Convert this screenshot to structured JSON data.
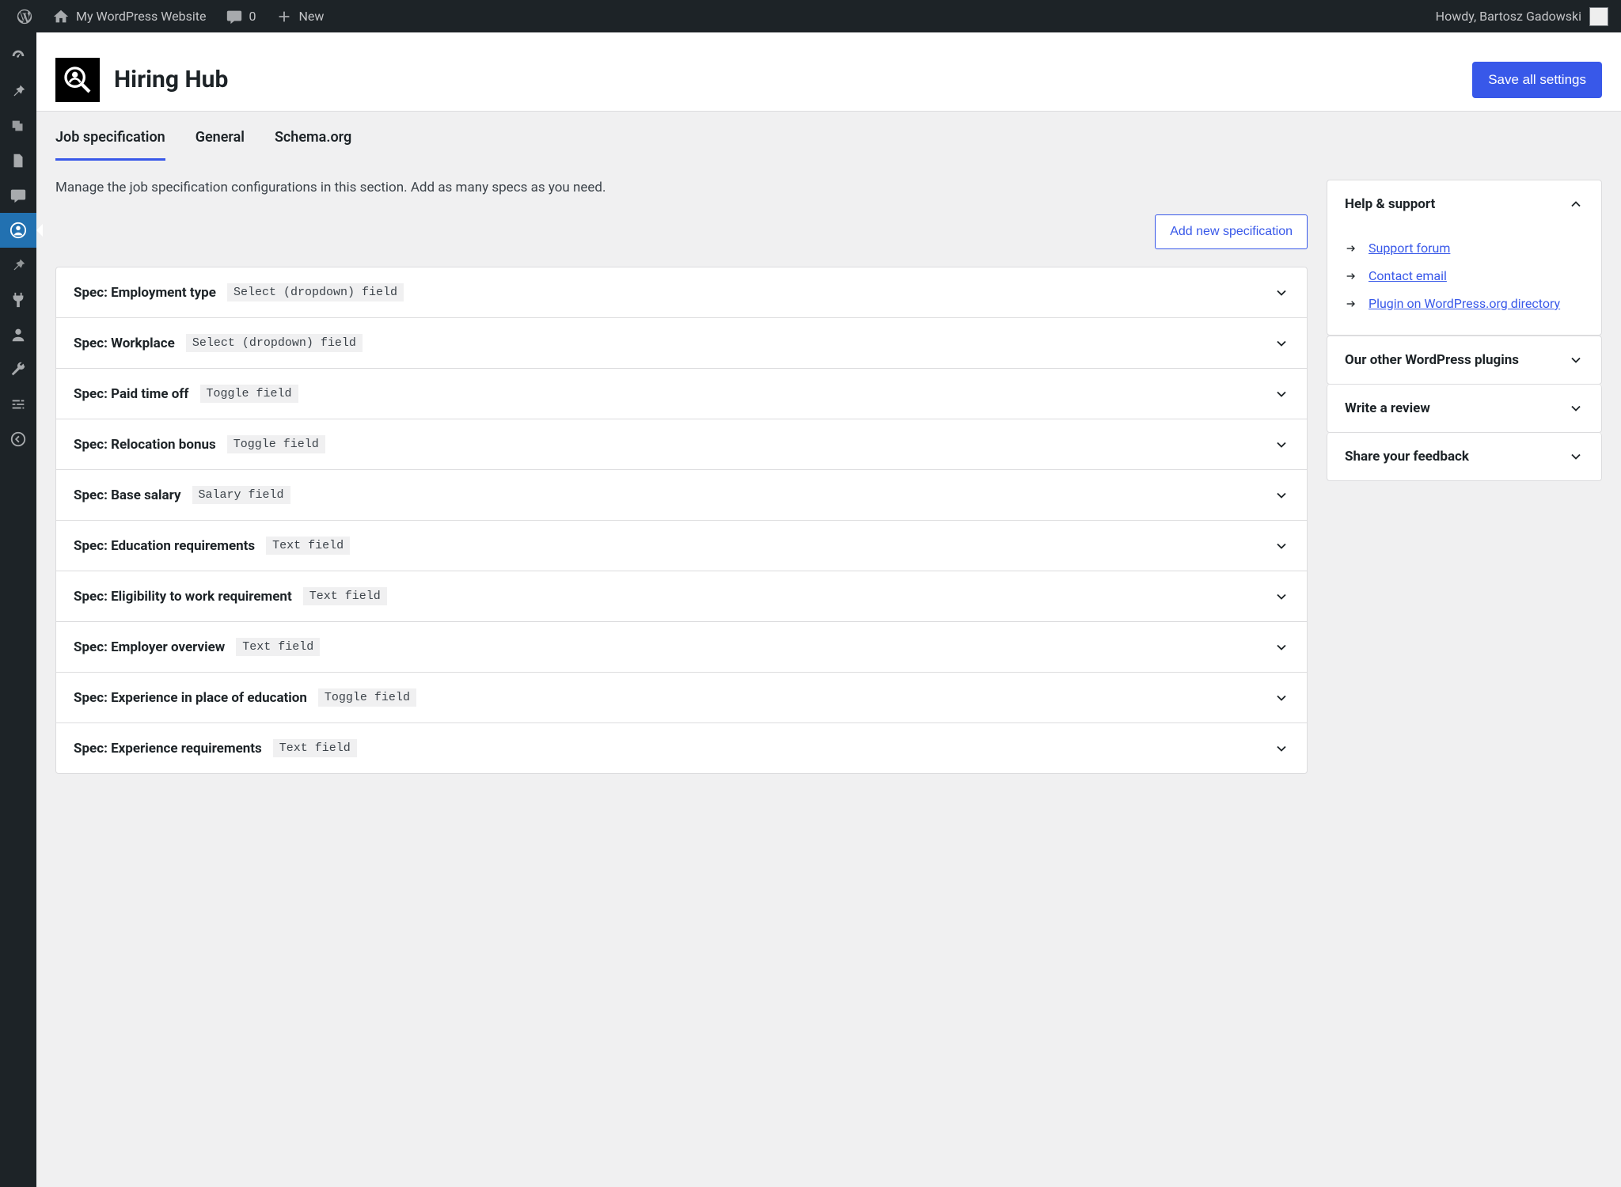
{
  "adminbar": {
    "site_name": "My WordPress Website",
    "comments_count": "0",
    "new_label": "New",
    "greeting": "Howdy, Bartosz Gadowski"
  },
  "page": {
    "title": "Hiring Hub",
    "save_button": "Save all settings"
  },
  "tabs": [
    {
      "label": "Job specification",
      "active": true
    },
    {
      "label": "General",
      "active": false
    },
    {
      "label": "Schema.org",
      "active": false
    }
  ],
  "description": "Manage the job specification configurations in this section. Add as many specs as you need.",
  "add_button": "Add new specification",
  "specs": [
    {
      "label": "Spec: Employment type",
      "type": "Select (dropdown) field"
    },
    {
      "label": "Spec: Workplace",
      "type": "Select (dropdown) field"
    },
    {
      "label": "Spec: Paid time off",
      "type": "Toggle field"
    },
    {
      "label": "Spec: Relocation bonus",
      "type": "Toggle field"
    },
    {
      "label": "Spec: Base salary",
      "type": "Salary field"
    },
    {
      "label": "Spec: Education requirements",
      "type": "Text field"
    },
    {
      "label": "Spec: Eligibility to work requirement",
      "type": "Text field"
    },
    {
      "label": "Spec: Employer overview",
      "type": "Text field"
    },
    {
      "label": "Spec: Experience in place of education",
      "type": "Toggle field"
    },
    {
      "label": "Spec: Experience requirements",
      "type": "Text field"
    }
  ],
  "help_panel": {
    "title": "Help & support",
    "links": [
      {
        "label": "Support forum"
      },
      {
        "label": "Contact email"
      },
      {
        "label": "Plugin on WordPress.org directory"
      }
    ]
  },
  "side_panels": [
    {
      "title": "Our other WordPress plugins"
    },
    {
      "title": "Write a review"
    },
    {
      "title": "Share your feedback"
    }
  ]
}
